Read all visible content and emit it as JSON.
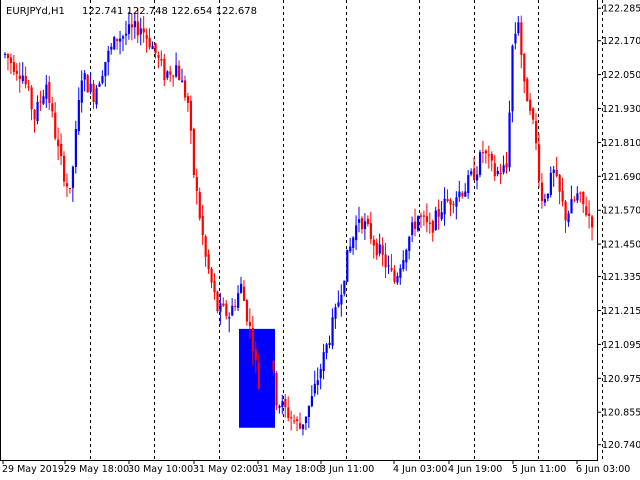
{
  "window": {
    "symbol_timeframe": "EURJPYd,H1",
    "ohlc": "122.741 122.748 122.654 122.678"
  },
  "colors": {
    "bull": "#0000ff",
    "bear": "#ff0000",
    "grid": "#000000",
    "background": "#ffffff",
    "highlight_box": "#0000ff"
  },
  "chart_data": {
    "type": "candlestick",
    "title": "",
    "xlabel": "",
    "ylabel": "",
    "ylim": [
      120.7,
      122.3
    ],
    "y_ticks": [
      "122.285",
      "122.170",
      "122.050",
      "121.930",
      "121.810",
      "121.690",
      "121.570",
      "121.450",
      "121.335",
      "121.215",
      "121.095",
      "120.975",
      "120.855",
      "120.740"
    ],
    "x_ticks": [
      "29 May 2019",
      "29 May 18:00",
      "30 May 10:00",
      "31 May 02:00",
      "31 May 18:00",
      "3 Jun 11:00",
      "4 Jun 03:00",
      "4 Jun 19:00",
      "5 Jun 11:00",
      "6 Jun 03:00"
    ],
    "grid": "vertical dashed at time labels",
    "highlight": {
      "x_start_index": 79,
      "x_end_index": 90,
      "y_top": 121.15,
      "y_bottom": 120.8
    },
    "close_path": [
      [
        0,
        122.12
      ],
      [
        6,
        122.05
      ],
      [
        10,
        121.9
      ],
      [
        14,
        122.02
      ],
      [
        18,
        121.78
      ],
      [
        22,
        121.62
      ],
      [
        26,
        122.05
      ],
      [
        30,
        121.98
      ],
      [
        34,
        122.1
      ],
      [
        38,
        122.18
      ],
      [
        42,
        122.2
      ],
      [
        46,
        122.22
      ],
      [
        50,
        122.15
      ],
      [
        54,
        122.05
      ],
      [
        58,
        122.08
      ],
      [
        62,
        121.95
      ],
      [
        64,
        121.7
      ],
      [
        68,
        121.4
      ],
      [
        72,
        121.22
      ],
      [
        76,
        121.2
      ],
      [
        80,
        121.3
      ],
      [
        84,
        121.1
      ],
      [
        86,
        120.95
      ],
      [
        90,
        121.05
      ],
      [
        92,
        120.9
      ],
      [
        96,
        120.85
      ],
      [
        100,
        120.8
      ],
      [
        104,
        120.9
      ],
      [
        108,
        121.05
      ],
      [
        112,
        121.2
      ],
      [
        116,
        121.4
      ],
      [
        120,
        121.55
      ],
      [
        124,
        121.48
      ],
      [
        128,
        121.4
      ],
      [
        132,
        121.32
      ],
      [
        136,
        121.45
      ],
      [
        140,
        121.55
      ],
      [
        144,
        121.5
      ],
      [
        148,
        121.58
      ],
      [
        152,
        121.62
      ],
      [
        156,
        121.65
      ],
      [
        160,
        121.72
      ],
      [
        162,
        121.78
      ],
      [
        166,
        121.7
      ],
      [
        170,
        121.72
      ],
      [
        172,
        122.15
      ],
      [
        174,
        122.25
      ],
      [
        176,
        122.0
      ],
      [
        178,
        121.95
      ],
      [
        180,
        121.8
      ],
      [
        182,
        121.6
      ],
      [
        186,
        121.7
      ],
      [
        190,
        121.55
      ],
      [
        194,
        121.62
      ],
      [
        198,
        121.55
      ],
      [
        200,
        121.52
      ]
    ]
  }
}
